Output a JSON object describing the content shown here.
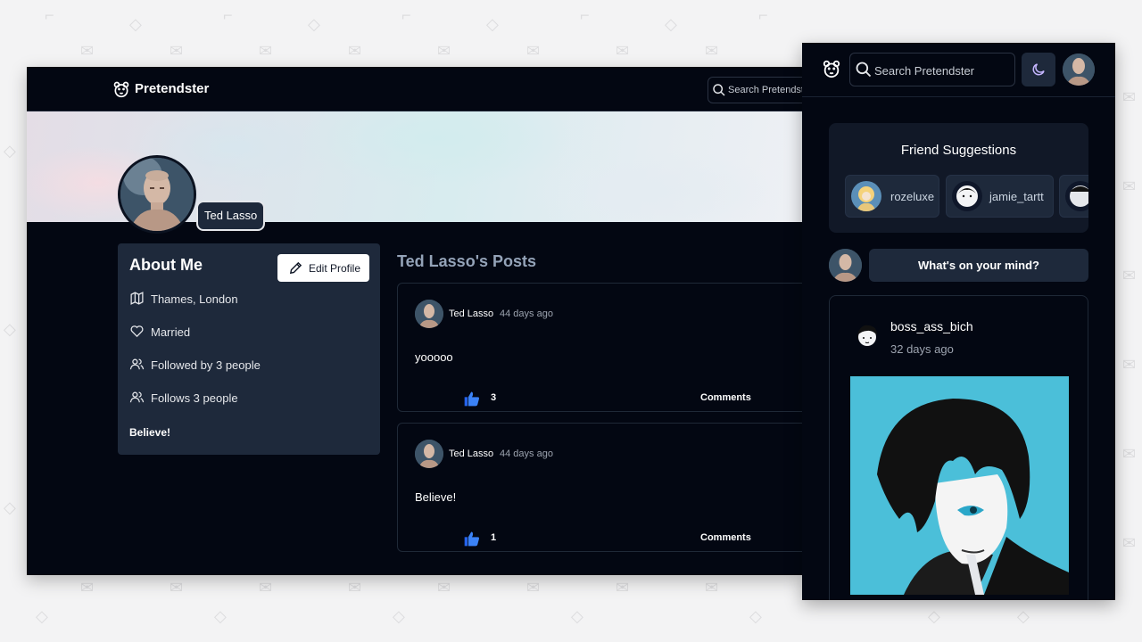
{
  "desktop": {
    "brand": "Pretendster",
    "search": {
      "placeholder": "Search Pretendster"
    },
    "profile": {
      "name": "Ted Lasso"
    },
    "about": {
      "title": "About Me",
      "edit_label": "Edit Profile",
      "rows": [
        {
          "icon": "map-icon",
          "text": "Thames, London"
        },
        {
          "icon": "heart-icon",
          "text": "Married"
        },
        {
          "icon": "users-icon",
          "text": "Followed by 3 people"
        },
        {
          "icon": "users-icon",
          "text": "Follows 3 people"
        }
      ],
      "motto": "Believe!"
    },
    "posts_title": "Ted Lasso's Posts",
    "posts": [
      {
        "author": "Ted Lasso",
        "time": "44 days ago",
        "body": "yooooo",
        "likes": "3",
        "comments_label": "Comments"
      },
      {
        "author": "Ted Lasso",
        "time": "44 days ago",
        "body": "Believe!",
        "likes": "1",
        "comments_label": "Comments"
      }
    ]
  },
  "mobile": {
    "search": {
      "placeholder": "Search Pretendster"
    },
    "suggestions": {
      "title": "Friend Suggestions",
      "items": [
        {
          "name": "rozeluxe"
        },
        {
          "name": "jamie_tartt"
        }
      ]
    },
    "compose_label": "What's on your mind?",
    "feed_post": {
      "author": "boss_ass_bich",
      "time": "32 days ago"
    }
  },
  "colors": {
    "background": "#030712",
    "card": "#1e293b",
    "like_blue": "#3b82f6",
    "image_bg": "#4bbfd9"
  }
}
